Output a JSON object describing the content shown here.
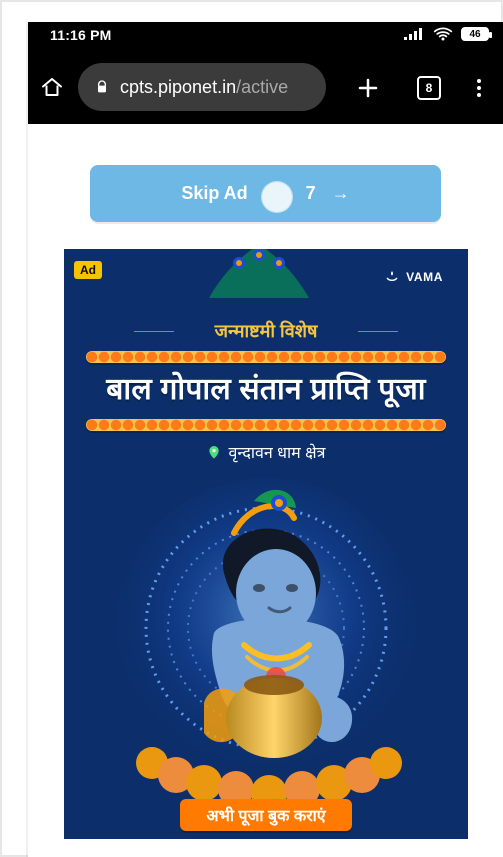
{
  "status_bar": {
    "time": "11:16 PM",
    "battery": "46"
  },
  "browser": {
    "url_domain": "cpts.piponet.in",
    "url_path": "/active",
    "tab_count": "8"
  },
  "skip_ad": {
    "label": "Skip Ad",
    "countdown": "7",
    "arrow": "→",
    "color": "#6db8e4"
  },
  "ad": {
    "badge": "Ad",
    "brand": "VAMA",
    "subtitle": "जन्माष्टमी विशेष",
    "title": "बाल गोपाल संतान प्राप्ति पूजा",
    "location": "वृन्दावन धाम क्षेत्र",
    "cta": "अभी पूजा बुक कराएं",
    "colors": {
      "background": "#0c2f6b",
      "accent": "#f4c542",
      "cta": "#ff7a00"
    }
  }
}
